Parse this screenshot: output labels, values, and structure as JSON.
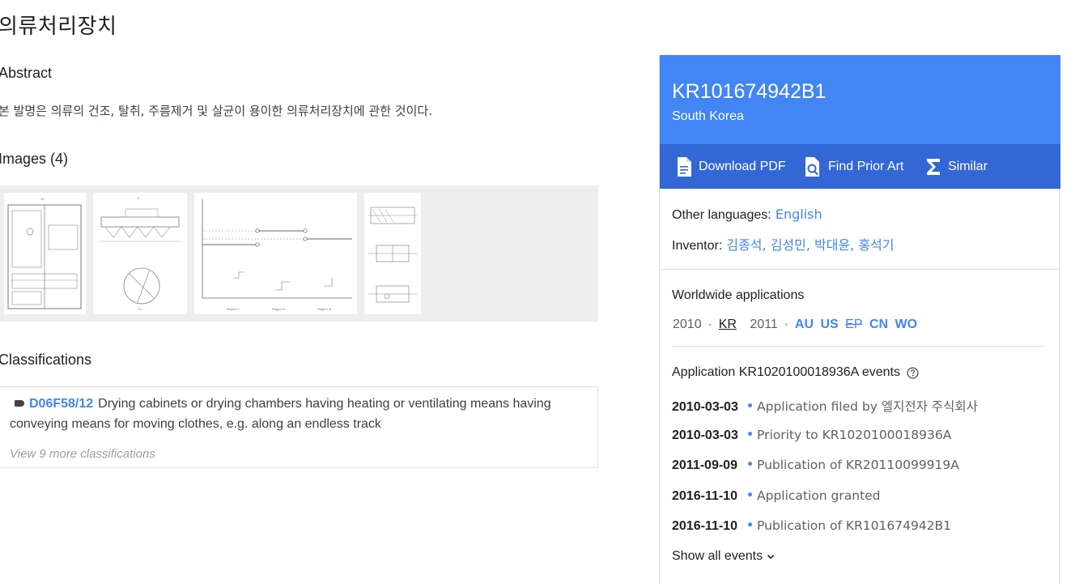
{
  "title": "의류처리장치",
  "abstract": {
    "heading": "Abstract",
    "text": "본 발명은 의류의 건조, 탈취, 주름제거 및 살균이 용이한 의류처리장치에 관한 것이다."
  },
  "images": {
    "heading": "Images (4)"
  },
  "classifications": {
    "heading": "Classifications",
    "code": "D06F58/12",
    "desc_line1": "Drying cabinets or drying chambers having heating or ventilating means having",
    "desc_line2": "conveying means for moving clothes, e.g. along an endless track",
    "view_more": "View 9 more classifications"
  },
  "sidebar": {
    "pub_number": "KR101674942B1",
    "country": "South Korea",
    "actions": {
      "download": "Download PDF",
      "prior_art": "Find Prior Art",
      "similar": "Similar"
    },
    "other_languages_label": "Other languages:",
    "other_languages_value": "English",
    "inventor_label": "Inventor:",
    "inventor_value": "김종석, 김성민, 박대윤, 홍석기",
    "worldwide": {
      "heading": "Worldwide applications",
      "year1": "2010",
      "kr": "KR",
      "year2": "2011",
      "au": "AU",
      "us": "US",
      "ep": "EP",
      "cn": "CN",
      "wo": "WO"
    },
    "events_heading": "Application KR1020100018936A events",
    "events": [
      {
        "date": "2010-03-03",
        "text": "Application filed by 엘지전자 주식회사"
      },
      {
        "date": "2010-03-03",
        "text": "Priority to KR1020100018936A"
      },
      {
        "date": "2011-09-09",
        "text": "Publication of KR20110099919A"
      },
      {
        "date": "2016-11-10",
        "text": "Application granted"
      },
      {
        "date": "2016-11-10",
        "text": "Publication of KR101674942B1"
      }
    ],
    "show_all": "Show all events"
  }
}
